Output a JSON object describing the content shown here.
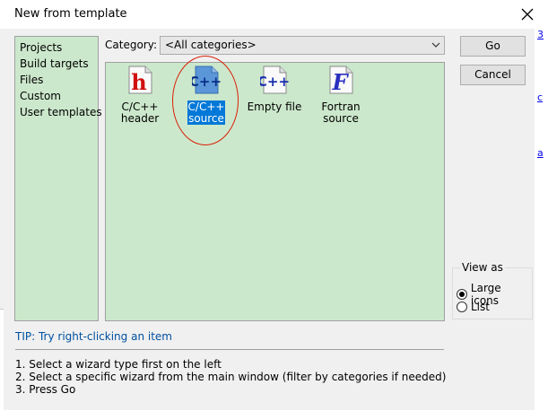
{
  "window": {
    "title": "New from template",
    "close_glyph": "✕"
  },
  "left_panel": {
    "items": [
      {
        "label": "Projects"
      },
      {
        "label": "Build targets"
      },
      {
        "label": "Files"
      },
      {
        "label": "Custom"
      },
      {
        "label": "User templates"
      }
    ]
  },
  "category": {
    "label": "Category:",
    "selected": "<All categories>"
  },
  "templates": [
    {
      "icon": "cpp-header-icon",
      "label_lines": [
        "C/C++",
        "header"
      ],
      "selected": false
    },
    {
      "icon": "cpp-source-icon",
      "label_lines": [
        "C/C++",
        "source"
      ],
      "selected": true
    },
    {
      "icon": "empty-file-icon",
      "label_lines": [
        "Empty file"
      ],
      "selected": false
    },
    {
      "icon": "fortran-source-icon",
      "label_lines": [
        "Fortran",
        "source"
      ],
      "selected": false
    }
  ],
  "buttons": {
    "go": "Go",
    "cancel": "Cancel"
  },
  "view_as": {
    "legend": "View as",
    "options": [
      {
        "label": "Large icons",
        "checked": true
      },
      {
        "label": "List",
        "checked": false
      }
    ]
  },
  "tip": "TIP: Try right-clicking an item",
  "steps": [
    "1. Select a wizard type first on the left",
    "2. Select a specific wizard from the main window (filter by categories if needed)",
    "3. Press Go"
  ],
  "colors": {
    "panel_bg": "#cce8cc",
    "selection": "#0078d7",
    "tip_text": "#0050a0",
    "annotation_circle": "#d81e06"
  }
}
